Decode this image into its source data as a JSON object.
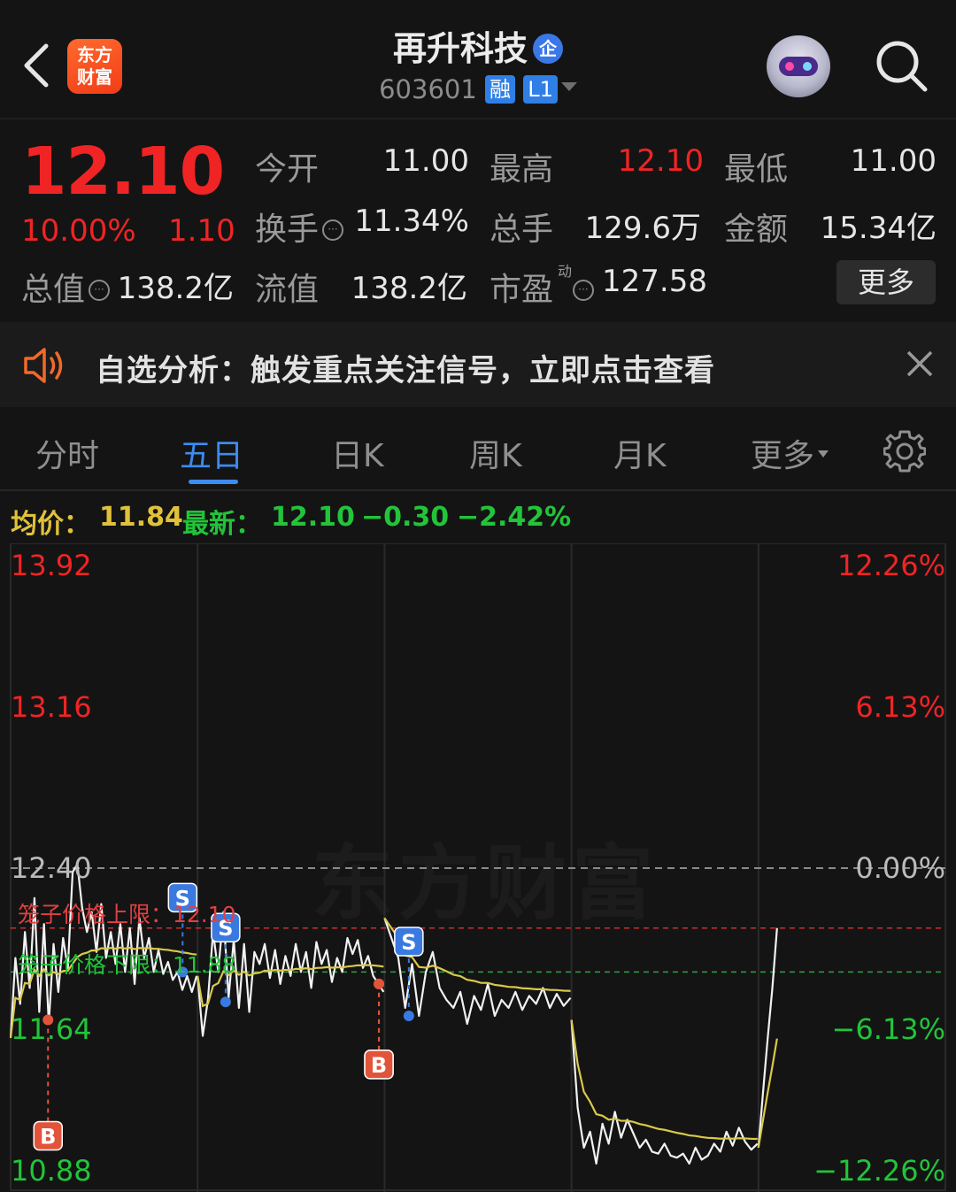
{
  "header": {
    "back_icon": "chevron-left-icon",
    "logo_text": "东方财富",
    "logo_line1": "东方",
    "logo_line2": "财富",
    "stock_name": "再升科技",
    "qi_badge": "企",
    "code": "603601",
    "tag_rong": "融",
    "tag_level": "L1",
    "avatar_icon": "robot-avatar-icon",
    "search_icon": "search-icon"
  },
  "quote": {
    "price": "12.10",
    "change_pct": "10.00%",
    "change_amt": "1.10",
    "open_label": "今开",
    "open": "11.00",
    "high_label": "最高",
    "high": "12.10",
    "low_label": "最低",
    "low": "11.00",
    "turnover_label": "换手",
    "turnover": "11.34%",
    "volume_label": "总手",
    "volume": "129.6万",
    "amount_label": "金额",
    "amount": "15.34亿",
    "mktcap_label": "总值",
    "mktcap": "138.2亿",
    "float_label": "流值",
    "float_cap": "138.2亿",
    "pe_label": "市盈",
    "pe_sup": "动",
    "pe": "127.58",
    "more_button": "更多",
    "colors": {
      "up": "#f02424",
      "down": "#22c43a"
    }
  },
  "notice": {
    "icon": "speaker-icon",
    "text": "自选分析：触发重点关注信号，立即点击查看",
    "close_icon": "close-icon"
  },
  "tabs": {
    "items": [
      "分时",
      "五日",
      "日K",
      "周K",
      "月K",
      "更多"
    ],
    "active": "五日",
    "settings_icon": "gear-icon"
  },
  "chart_header": {
    "avg_label": "均价：",
    "avg_value": "11.84",
    "latest_label": "最新：",
    "latest_value": "12.10",
    "diff": "−0.30",
    "diff_pct": "−2.42%"
  },
  "chart_data": {
    "type": "line",
    "title": "",
    "y_left_ticks": [
      "13.92",
      "13.16",
      "12.40",
      "11.64",
      "10.88"
    ],
    "y_right_ticks": [
      "12.26%",
      "6.13%",
      "0.00%",
      "−6.13%",
      "−12.26%"
    ],
    "ylim": [
      10.88,
      13.92
    ],
    "reference_price": 12.4,
    "days": 5,
    "watermark": "东方财富",
    "cage_upper": {
      "label": "笼子价格上限：12.10",
      "value": 12.1
    },
    "cage_lower": {
      "label": "笼子价格下限：11.88",
      "value": 11.88
    },
    "series": [
      {
        "name": "",
        "day1": [
          11.55,
          11.95,
          11.72,
          12.08,
          11.8,
          12.25,
          11.68,
          12.12,
          11.62,
          12.02,
          11.78,
          12.05,
          11.9,
          12.38,
          12.42,
          12.2,
          12.08,
          12.18,
          11.98,
          12.22,
          11.95,
          12.08,
          11.92,
          12.12,
          11.88,
          12.1,
          11.82,
          12.15,
          11.95,
          12.05,
          11.88,
          11.99,
          11.87,
          11.93,
          11.84,
          11.88,
          11.79,
          11.86,
          11.78,
          11.86
        ],
        "day2": [
          11.86,
          11.56,
          11.74,
          12.08,
          11.88,
          12.18,
          11.75,
          12.04,
          11.7,
          12.02,
          11.68,
          11.98,
          11.92,
          12.02,
          11.85,
          11.99,
          11.82,
          11.96,
          11.86,
          12.02,
          11.88,
          11.98,
          11.8,
          12.03,
          11.92,
          11.99,
          11.83,
          11.95,
          11.88,
          12.05,
          11.97,
          12.04,
          11.9,
          11.96,
          11.86,
          11.82,
          11.78
        ],
        "day3": [
          12.15,
          12.05,
          11.95,
          11.7,
          11.92,
          11.66,
          11.88,
          11.98,
          11.8,
          11.74,
          11.7,
          11.78,
          11.62,
          11.76,
          11.69,
          11.82,
          11.66,
          11.74,
          11.7,
          11.78,
          11.69,
          11.76,
          11.72,
          11.8,
          11.7,
          11.77,
          11.71,
          11.75
        ],
        "day4": [
          11.64,
          11.2,
          11.0,
          11.08,
          10.92,
          11.12,
          11.02,
          11.18,
          11.05,
          11.14,
          11.07,
          11.0,
          11.04,
          10.98,
          10.97,
          11.02,
          10.96,
          10.95,
          10.97,
          10.92,
          11.0,
          10.94,
          10.96,
          11.02,
          10.98,
          11.08,
          11.01,
          11.1,
          11.03,
          10.99,
          11.02
        ],
        "day5": [
          11.0,
          11.28,
          11.55,
          11.8,
          12.1
        ]
      }
    ],
    "avg_line": {
      "name": ""
    },
    "markers": [
      {
        "type": "B",
        "day": 1,
        "price": 11.64
      },
      {
        "type": "S",
        "day": 1,
        "price": 11.88
      },
      {
        "type": "B",
        "day": 2,
        "price": 11.82
      },
      {
        "type": "S",
        "day": 2,
        "price": 11.73
      },
      {
        "type": "B",
        "day": 2,
        "price": 11.82
      },
      {
        "type": "S",
        "day": 3,
        "price": 11.66
      }
    ],
    "colors": {
      "price_line": "#f2f2f2",
      "avg_line": "#d9c94a",
      "up": "#f02424",
      "down": "#22c43a",
      "marker_s": "#3a7ae0",
      "marker_b": "#e2543a"
    }
  }
}
